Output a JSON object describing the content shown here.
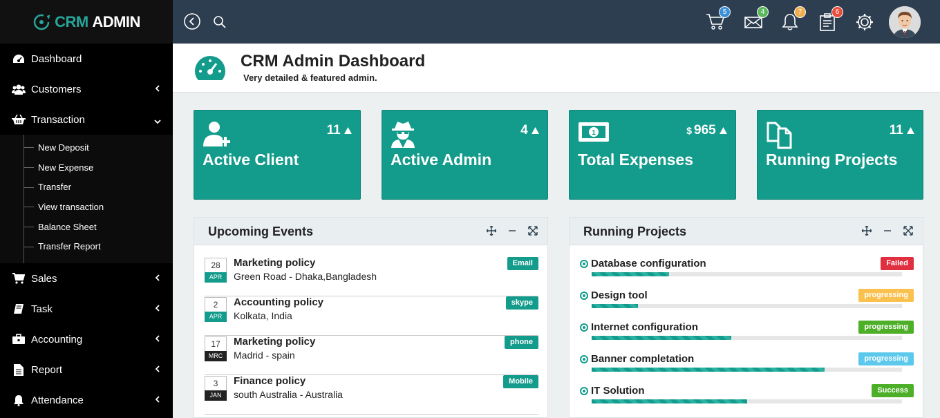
{
  "app": {
    "logo_prefix": "CRM",
    "logo_suffix": "ADMIN"
  },
  "sidebar": {
    "items_top": [
      {
        "label": "Dashboard",
        "icon": "dashboard-icon"
      },
      {
        "label": "Customers",
        "icon": "users-icon"
      },
      {
        "label": "Transaction",
        "icon": "basket-icon"
      }
    ],
    "transaction_sub": [
      "New Deposit",
      "New Expense",
      "Transfer",
      "View transaction",
      "Balance Sheet",
      "Transfer Report"
    ],
    "items_bottom": [
      {
        "label": "Sales",
        "icon": "cart-icon"
      },
      {
        "label": "Task",
        "icon": "book-icon"
      },
      {
        "label": "Accounting",
        "icon": "briefcase-icon"
      },
      {
        "label": "Report",
        "icon": "file-icon"
      },
      {
        "label": "Attendance",
        "icon": "bell-icon"
      }
    ]
  },
  "topbar": {
    "cart_count": "5",
    "mail_count": "4",
    "bell_count": "7",
    "tasks_count": "6",
    "colors": {
      "cart": "#3a8fd8",
      "mail": "#5cb85c",
      "bell": "#f0ad4e",
      "tasks": "#e74c3c"
    }
  },
  "header": {
    "title": "CRM Admin Dashboard",
    "subtitle": "Very detailed & featured admin."
  },
  "stats": [
    {
      "label": "Active Client",
      "value": "11",
      "prefix": ""
    },
    {
      "label": "Active Admin",
      "value": "4",
      "prefix": ""
    },
    {
      "label": "Total Expenses",
      "value": "965",
      "prefix": "$"
    },
    {
      "label": "Running Projects",
      "value": "11",
      "prefix": ""
    }
  ],
  "events": {
    "title": "Upcoming Events",
    "items": [
      {
        "day": "28",
        "month": "APR",
        "title": "Marketing policy",
        "location": "Green Road - Dhaka,Bangladesh",
        "tag": "Email",
        "month_color": "#139b8b"
      },
      {
        "day": "2",
        "month": "APR",
        "title": "Accounting policy",
        "location": "Kolkata, India",
        "tag": "skype",
        "month_color": "#139b8b"
      },
      {
        "day": "17",
        "month": "MRC",
        "title": "Marketing policy",
        "location": "Madrid - spain",
        "tag": "phone",
        "month_color": "#222222"
      },
      {
        "day": "3",
        "month": "JAN",
        "title": "Finance policy",
        "location": "south Australia - Australia",
        "tag": "Mobile",
        "month_color": "#222222"
      }
    ]
  },
  "projects": {
    "title": "Running Projects",
    "items": [
      {
        "name": "Database configuration",
        "status": "Failed",
        "color": "#e02f3f",
        "progress": 0.25
      },
      {
        "name": "Design tool",
        "status": "progressing",
        "color": "#fbc14e",
        "progress": 0.15
      },
      {
        "name": "Internet configuration",
        "status": "progressing",
        "color": "#4caf27",
        "progress": 0.45
      },
      {
        "name": "Banner completation",
        "status": "progressing",
        "color": "#5bc8ec",
        "progress": 0.75
      },
      {
        "name": "IT Solution",
        "status": "Success",
        "color": "#4caf27",
        "progress": 0.5
      }
    ]
  }
}
